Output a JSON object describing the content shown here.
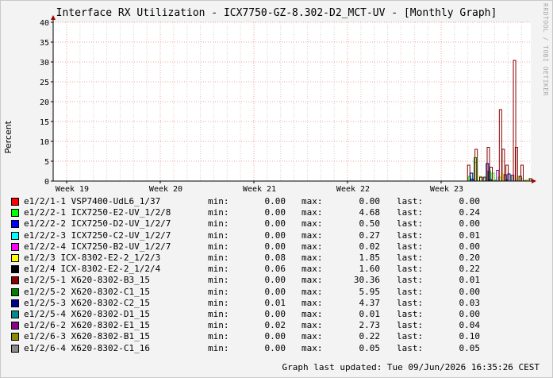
{
  "watermark": "RRDTOOL / TOBI OETIKER",
  "updated": "Graph last updated: Tue 09/Jun/2026 16:35:26 CEST",
  "labels": {
    "min": "min:",
    "max": "max:",
    "last": "last:"
  },
  "chart_data": {
    "type": "bar",
    "title": "Interface RX Utilization - ICX7750-GZ-8.302-D2_MCT-UV - [Monthly Graph]",
    "ylabel": "Percent",
    "ylim": [
      0,
      40
    ],
    "yticks": [
      0,
      5,
      10,
      15,
      20,
      25,
      30,
      35,
      40
    ],
    "xticks": [
      "Week 19",
      "Week 20",
      "Week 21",
      "Week 22",
      "Week 23"
    ],
    "grid": true,
    "legend_position": "bottom",
    "series": [
      {
        "name": "e1/2/1-1 VSP7400-UdL6_1/37",
        "color": "#ff0000",
        "min": "0.00",
        "max": "0.00",
        "last": "0.00",
        "bars": []
      },
      {
        "name": "e1/2/2-1 ICX7250-E2-UV_1/2/8",
        "color": "#00ff00",
        "min": "0.00",
        "max": "4.68",
        "last": "0.24",
        "bars": [
          [
            5.3,
            1.2
          ],
          [
            5.36,
            4.7
          ],
          [
            5.45,
            0.8
          ],
          [
            5.55,
            2.0
          ],
          [
            5.62,
            1.0
          ],
          [
            5.75,
            1.5
          ],
          [
            5.86,
            0.6
          ]
        ]
      },
      {
        "name": "e1/2/2-2 ICX7250-D2-UV_1/2/7",
        "color": "#0000ff",
        "min": "0.00",
        "max": "0.50",
        "last": "0.00",
        "bars": [
          [
            5.33,
            0.5
          ],
          [
            5.52,
            0.4
          ],
          [
            5.7,
            0.3
          ]
        ]
      },
      {
        "name": "e1/2/2-3 ICX7250-C2-UV_1/2/7",
        "color": "#00ffff",
        "min": "0.00",
        "max": "0.27",
        "last": "0.01",
        "bars": [
          [
            5.58,
            0.27
          ],
          [
            5.8,
            0.2
          ]
        ]
      },
      {
        "name": "e1/2/2-4 ICX7250-B2-UV_1/2/7",
        "color": "#ff00ff",
        "min": "0.00",
        "max": "0.02",
        "last": "0.00",
        "bars": []
      },
      {
        "name": "e1/2/3 ICX-8302-E2-2_1/2/3",
        "color": "#ffff00",
        "min": "0.08",
        "max": "1.85",
        "last": "0.20",
        "bars": [
          [
            5.4,
            1.3
          ],
          [
            5.65,
            1.85
          ],
          [
            5.82,
            1.0
          ],
          [
            5.93,
            0.5
          ]
        ]
      },
      {
        "name": "e1/2/4 ICX-8302-E2-2_1/2/4",
        "color": "#000000",
        "min": "0.06",
        "max": "1.60",
        "last": "0.22",
        "bars": [
          [
            5.42,
            1.0
          ],
          [
            5.68,
            1.6
          ],
          [
            5.84,
            1.2
          ],
          [
            5.95,
            0.6
          ]
        ]
      },
      {
        "name": "e1/2/5-1 X620-8302-B3_15",
        "color": "#8b0000",
        "min": "0.00",
        "max": "30.36",
        "last": "0.01",
        "bars": [
          [
            5.29,
            4.0
          ],
          [
            5.37,
            8.0
          ],
          [
            5.5,
            8.5
          ],
          [
            5.53,
            3.5
          ],
          [
            5.63,
            18.0
          ],
          [
            5.66,
            8.0
          ],
          [
            5.7,
            4.0
          ],
          [
            5.78,
            30.4
          ],
          [
            5.8,
            8.5
          ],
          [
            5.86,
            4.0
          ]
        ]
      },
      {
        "name": "e1/2/5-2 X620-8302-C1_15",
        "color": "#008000",
        "min": "0.00",
        "max": "5.95",
        "last": "0.00",
        "bars": [
          [
            5.36,
            5.9
          ],
          [
            5.51,
            2.5
          ]
        ]
      },
      {
        "name": "e1/2/5-3 X620-8302-C2_15",
        "color": "#00008b",
        "min": "0.01",
        "max": "4.37",
        "last": "0.03",
        "bars": [
          [
            5.32,
            2.0
          ],
          [
            5.49,
            4.4
          ],
          [
            5.72,
            1.8
          ]
        ]
      },
      {
        "name": "e1/2/5-4 X620-8302-D1_15",
        "color": "#008b8b",
        "min": "0.00",
        "max": "0.01",
        "last": "0.00",
        "bars": []
      },
      {
        "name": "e1/2/6-2 X620-8302-E1_15",
        "color": "#8b008b",
        "min": "0.02",
        "max": "2.73",
        "last": "0.04",
        "bars": [
          [
            5.46,
            1.0
          ],
          [
            5.6,
            2.7
          ],
          [
            5.76,
            1.5
          ]
        ]
      },
      {
        "name": "e1/2/6-3 X620-8302-B1_15",
        "color": "#8b8b00",
        "min": "0.00",
        "max": "0.22",
        "last": "0.10",
        "bars": [
          [
            5.57,
            0.22
          ],
          [
            5.9,
            0.2
          ]
        ]
      },
      {
        "name": "e1/2/6-4 X620-8302-C1_16",
        "color": "#8b8b8b",
        "min": "0.00",
        "max": "0.05",
        "last": "0.05",
        "bars": []
      }
    ]
  }
}
